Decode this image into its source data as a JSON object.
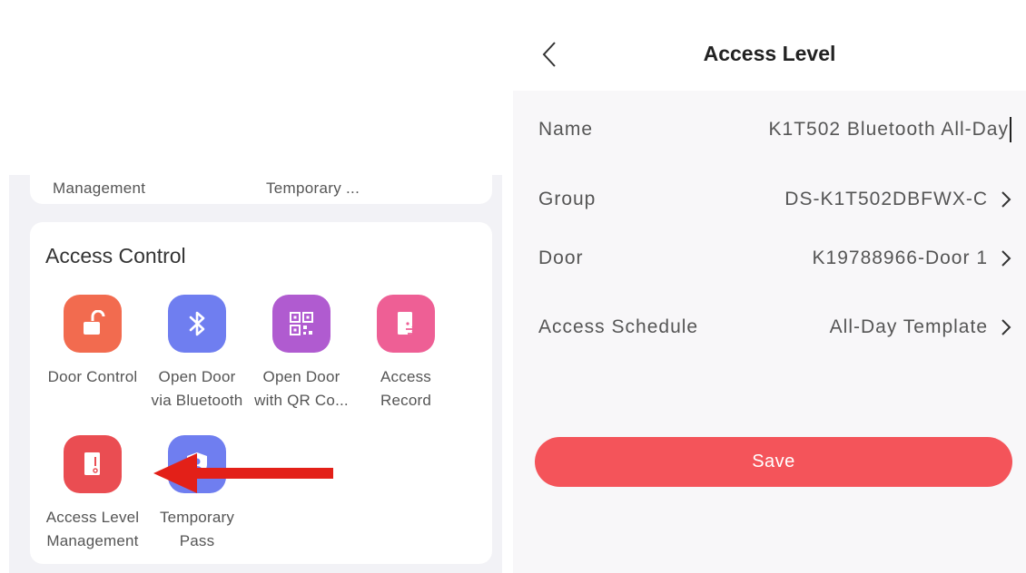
{
  "left": {
    "top_card": {
      "label_1": "Management",
      "label_2": "Temporary ..."
    },
    "section_title": "Access Control",
    "tiles": [
      {
        "label": "Door Control",
        "icon": "unlock-icon",
        "color": "#f26b4f"
      },
      {
        "label": "Open Door\nvia Bluetooth",
        "icon": "bluetooth-icon",
        "color": "#6f7ef0"
      },
      {
        "label": "Open Door\nwith QR Co...",
        "icon": "qr-code-icon",
        "color": "#b05bd0"
      },
      {
        "label": "Access\nRecord",
        "icon": "door-record-icon",
        "color": "#ee5f95"
      },
      {
        "label": "Access Level\nManagement",
        "icon": "access-level-icon",
        "color": "#ea4d52"
      },
      {
        "label": "Temporary\nPass",
        "icon": "shield-pass-icon",
        "color": "#6f7ef0"
      }
    ],
    "arrow_color": "#e32018"
  },
  "right": {
    "title": "Access Level",
    "name": {
      "label": "Name",
      "value": "K1T502 Bluetooth All-Day"
    },
    "group": {
      "label": "Group",
      "value": "DS-K1T502DBFWX-C"
    },
    "door": {
      "label": "Door",
      "value": "K19788966-Door 1"
    },
    "schedule": {
      "label": "Access Schedule",
      "value": "All-Day Template"
    },
    "save_label": "Save",
    "save_color": "#f4545a"
  }
}
